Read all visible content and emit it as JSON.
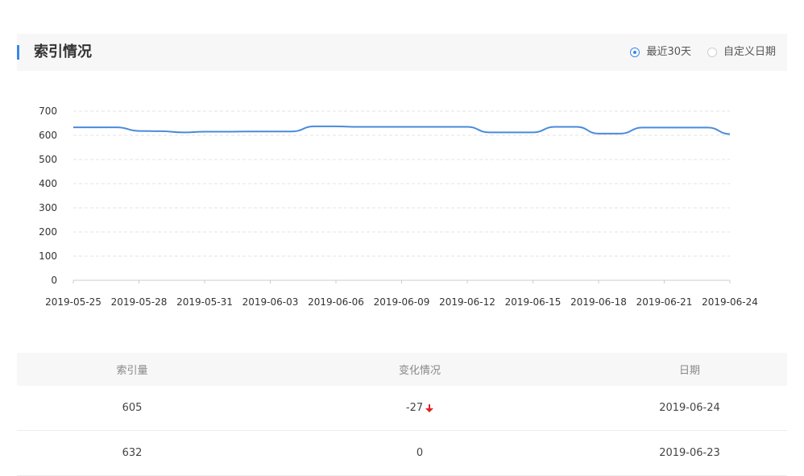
{
  "header": {
    "title": "索引情况",
    "options": [
      {
        "label": "最近30天",
        "selected": true
      },
      {
        "label": "自定义日期",
        "selected": false
      }
    ]
  },
  "chart_data": {
    "type": "line",
    "title": "",
    "xlabel": "",
    "ylabel": "",
    "ylim": [
      0,
      700
    ],
    "yticks": [
      0,
      100,
      200,
      300,
      400,
      500,
      600,
      700
    ],
    "x": [
      "2019-05-25",
      "2019-05-26",
      "2019-05-27",
      "2019-05-28",
      "2019-05-29",
      "2019-05-30",
      "2019-05-31",
      "2019-06-01",
      "2019-06-02",
      "2019-06-03",
      "2019-06-04",
      "2019-06-05",
      "2019-06-06",
      "2019-06-07",
      "2019-06-08",
      "2019-06-09",
      "2019-06-10",
      "2019-06-11",
      "2019-06-12",
      "2019-06-13",
      "2019-06-14",
      "2019-06-15",
      "2019-06-16",
      "2019-06-17",
      "2019-06-18",
      "2019-06-19",
      "2019-06-20",
      "2019-06-21",
      "2019-06-22",
      "2019-06-23",
      "2019-06-24"
    ],
    "xtick_labels": [
      "2019-05-25",
      "2019-05-28",
      "2019-05-31",
      "2019-06-03",
      "2019-06-06",
      "2019-06-09",
      "2019-06-12",
      "2019-06-15",
      "2019-06-18",
      "2019-06-21",
      "2019-06-24"
    ],
    "series": [
      {
        "values": [
          633,
          633,
          633,
          618,
          617,
          612,
          615,
          615,
          616,
          616,
          616,
          637,
          637,
          635,
          635,
          635,
          635,
          635,
          635,
          612,
          612,
          612,
          635,
          635,
          607,
          607,
          632,
          632,
          632,
          632,
          605
        ]
      }
    ],
    "grid": true,
    "line_color": "#4a8bdb"
  },
  "table": {
    "headers": [
      "索引量",
      "变化情况",
      "日期"
    ],
    "rows": [
      {
        "count": "605",
        "change": "-27",
        "direction": "down",
        "date": "2019-06-24"
      },
      {
        "count": "632",
        "change": "0",
        "direction": "none",
        "date": "2019-06-23"
      }
    ],
    "down_color": "#e02020"
  }
}
